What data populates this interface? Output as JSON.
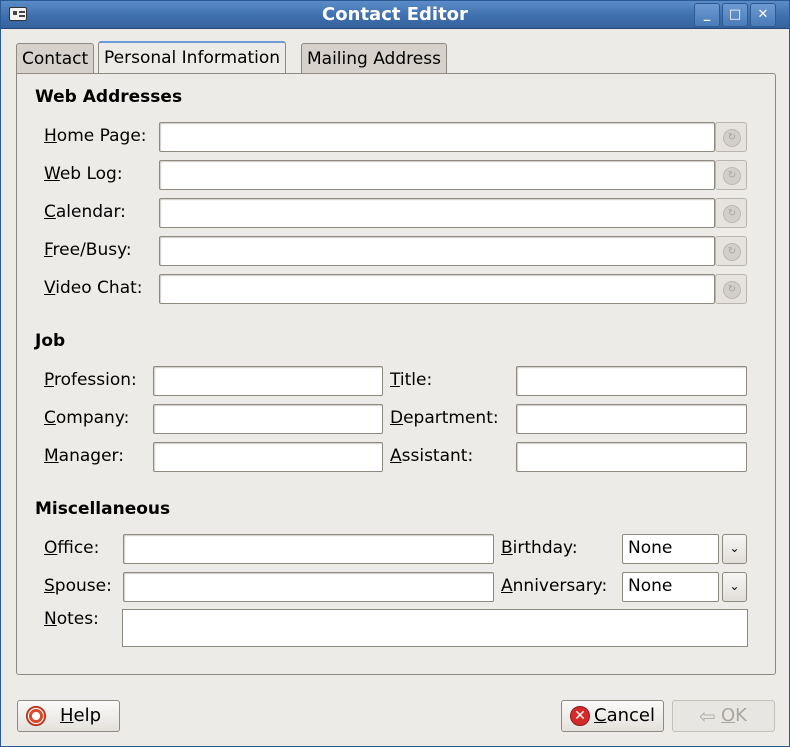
{
  "window": {
    "title": "Contact Editor"
  },
  "tabs": [
    {
      "label": "Contact"
    },
    {
      "label": "Personal Information"
    },
    {
      "label": "Mailing Address"
    }
  ],
  "web": {
    "heading": "Web Addresses",
    "fields": [
      {
        "mnemonic": "H",
        "rest": "ome Page:",
        "value": ""
      },
      {
        "mnemonic": "W",
        "rest": "eb Log:",
        "value": ""
      },
      {
        "mnemonic": "C",
        "rest": "alendar:",
        "value": ""
      },
      {
        "mnemonic": "F",
        "rest": "ree/Busy:",
        "value": ""
      },
      {
        "mnemonic": "V",
        "rest": "ideo Chat:",
        "value": ""
      }
    ]
  },
  "job": {
    "heading": "Job",
    "profession": {
      "mnemonic": "P",
      "rest": "rofession:",
      "value": ""
    },
    "title": {
      "mnemonic": "T",
      "rest": "itle:",
      "value": ""
    },
    "company": {
      "mnemonic": "C",
      "rest": "ompany:",
      "value": ""
    },
    "department": {
      "mnemonic": "D",
      "rest": "epartment:",
      "value": ""
    },
    "manager": {
      "mnemonic": "M",
      "rest": "anager:",
      "value": ""
    },
    "assistant": {
      "mnemonic": "A",
      "rest": "ssistant:",
      "value": ""
    }
  },
  "misc": {
    "heading": "Miscellaneous",
    "office": {
      "mnemonic": "O",
      "rest": "ffice:",
      "value": ""
    },
    "spouse": {
      "mnemonic": "S",
      "rest": "pouse:",
      "value": ""
    },
    "notes": {
      "mnemonic": "N",
      "rest": "otes:",
      "value": ""
    },
    "birthday": {
      "mnemonic": "B",
      "rest": "irthday:",
      "value": "None"
    },
    "anniversary": {
      "mnemonic": "A",
      "rest": "nniversary:",
      "value": "None"
    }
  },
  "buttons": {
    "help": {
      "mnemonic": "H",
      "rest": "elp"
    },
    "cancel": {
      "mnemonic": "C",
      "rest": "ancel"
    },
    "ok": {
      "mnemonic": "O",
      "rest": "K"
    }
  },
  "icons": {
    "window": "address-card-icon",
    "help": "lifebuoy-icon",
    "cancel": "cancel-icon",
    "ok": "ok-arrow-icon",
    "link": "open-link-icon"
  }
}
